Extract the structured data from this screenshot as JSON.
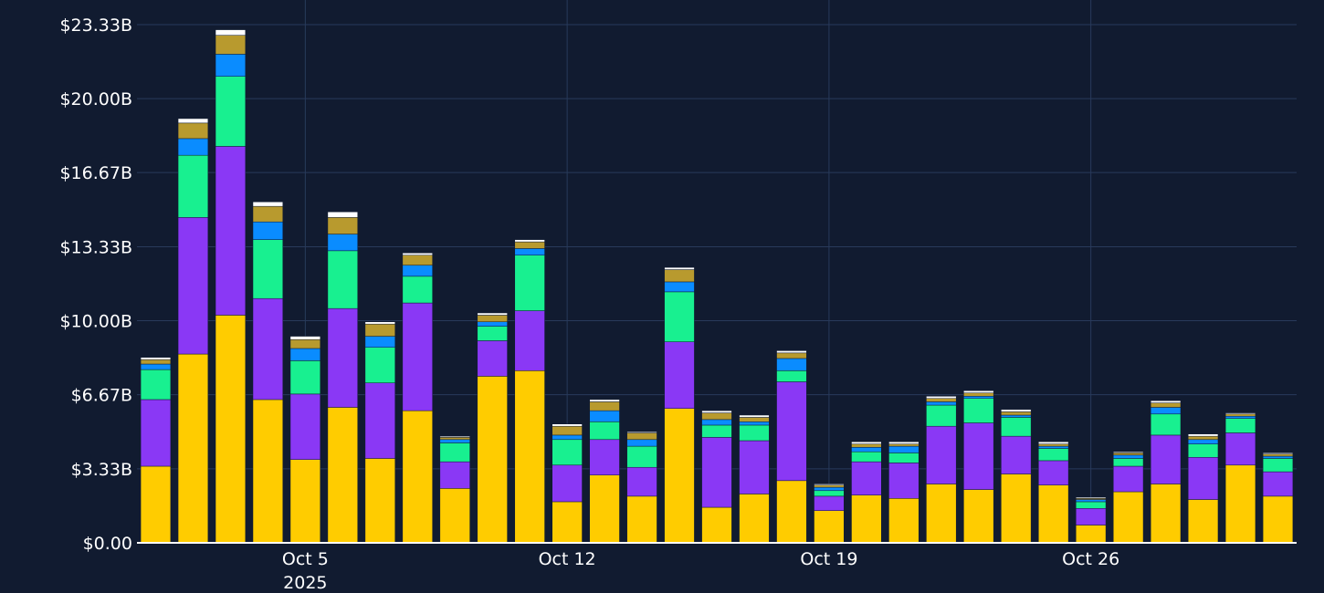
{
  "chart_data": {
    "type": "bar",
    "stacked": true,
    "title": "",
    "xlabel": "",
    "ylabel": "",
    "ylim": [
      0,
      23.33
    ],
    "yticks": [
      0,
      3.33,
      6.67,
      10.0,
      13.33,
      16.67,
      20.0,
      23.33
    ],
    "ytick_labels": [
      "$0.00",
      "$3.33B",
      "$6.67B",
      "$10.00B",
      "$13.33B",
      "$16.67B",
      "$20.00B",
      "$23.33B"
    ],
    "xticks": [
      {
        "date": "2025-10-05",
        "label": "Oct 5",
        "sublabel": "2025"
      },
      {
        "date": "2025-10-12",
        "label": "Oct 12",
        "sublabel": ""
      },
      {
        "date": "2025-10-19",
        "label": "Oct 19",
        "sublabel": ""
      },
      {
        "date": "2025-10-26",
        "label": "Oct 26",
        "sublabel": ""
      }
    ],
    "x": [
      "2025-10-01",
      "2025-10-02",
      "2025-10-03",
      "2025-10-04",
      "2025-10-05",
      "2025-10-06",
      "2025-10-07",
      "2025-10-08",
      "2025-10-09",
      "2025-10-10",
      "2025-10-11",
      "2025-10-12",
      "2025-10-13",
      "2025-10-14",
      "2025-10-15",
      "2025-10-16",
      "2025-10-17",
      "2025-10-18",
      "2025-10-19",
      "2025-10-20",
      "2025-10-21",
      "2025-10-22",
      "2025-10-23",
      "2025-10-24",
      "2025-10-25",
      "2025-10-26",
      "2025-10-27",
      "2025-10-28",
      "2025-10-29",
      "2025-10-30",
      "2025-10-31"
    ],
    "grid": true,
    "legend": "none",
    "series": [
      {
        "color": "#ffcc00",
        "values": [
          3.45,
          8.5,
          10.25,
          6.45,
          3.75,
          6.1,
          3.8,
          5.95,
          2.45,
          7.5,
          7.75,
          1.85,
          3.05,
          2.1,
          6.05,
          1.6,
          2.2,
          2.8,
          1.45,
          2.15,
          2.0,
          2.65,
          2.4,
          3.1,
          2.6,
          0.8,
          2.3,
          2.65,
          1.95,
          3.5,
          2.1
        ]
      },
      {
        "color": "#8a38f5",
        "values": [
          3.0,
          6.15,
          7.6,
          4.55,
          2.95,
          4.45,
          3.4,
          4.85,
          1.2,
          1.6,
          2.7,
          1.65,
          1.6,
          1.3,
          3.0,
          3.15,
          2.4,
          4.45,
          0.65,
          1.5,
          1.6,
          2.6,
          3.0,
          1.7,
          1.1,
          0.75,
          1.15,
          2.2,
          1.9,
          1.45,
          1.1
        ]
      },
      {
        "color": "#18f090",
        "values": [
          1.35,
          2.8,
          3.15,
          2.65,
          1.5,
          2.6,
          1.6,
          1.2,
          0.85,
          0.65,
          2.5,
          1.15,
          0.8,
          0.95,
          2.25,
          0.55,
          0.7,
          0.5,
          0.25,
          0.45,
          0.45,
          0.95,
          1.1,
          0.85,
          0.55,
          0.3,
          0.35,
          0.95,
          0.6,
          0.65,
          0.6
        ]
      },
      {
        "color": "#0a8cff",
        "values": [
          0.25,
          0.75,
          1.0,
          0.8,
          0.55,
          0.75,
          0.5,
          0.5,
          0.15,
          0.2,
          0.3,
          0.2,
          0.5,
          0.3,
          0.45,
          0.25,
          0.15,
          0.55,
          0.15,
          0.2,
          0.3,
          0.15,
          0.1,
          0.1,
          0.1,
          0.1,
          0.15,
          0.3,
          0.2,
          0.1,
          0.1
        ]
      },
      {
        "color": "#b89a2e",
        "values": [
          0.2,
          0.7,
          0.85,
          0.7,
          0.4,
          0.75,
          0.55,
          0.45,
          0.1,
          0.3,
          0.3,
          0.4,
          0.4,
          0.3,
          0.55,
          0.3,
          0.2,
          0.25,
          0.1,
          0.15,
          0.1,
          0.15,
          0.15,
          0.15,
          0.1,
          0.05,
          0.1,
          0.2,
          0.15,
          0.1,
          0.1
        ]
      },
      {
        "color": "#ffffff",
        "values": [
          0.1,
          0.2,
          0.25,
          0.2,
          0.15,
          0.25,
          0.1,
          0.1,
          0.05,
          0.1,
          0.1,
          0.1,
          0.1,
          0.05,
          0.1,
          0.1,
          0.1,
          0.1,
          0.05,
          0.1,
          0.1,
          0.1,
          0.1,
          0.1,
          0.1,
          0.05,
          0.05,
          0.1,
          0.1,
          0.05,
          0.05
        ]
      }
    ]
  }
}
